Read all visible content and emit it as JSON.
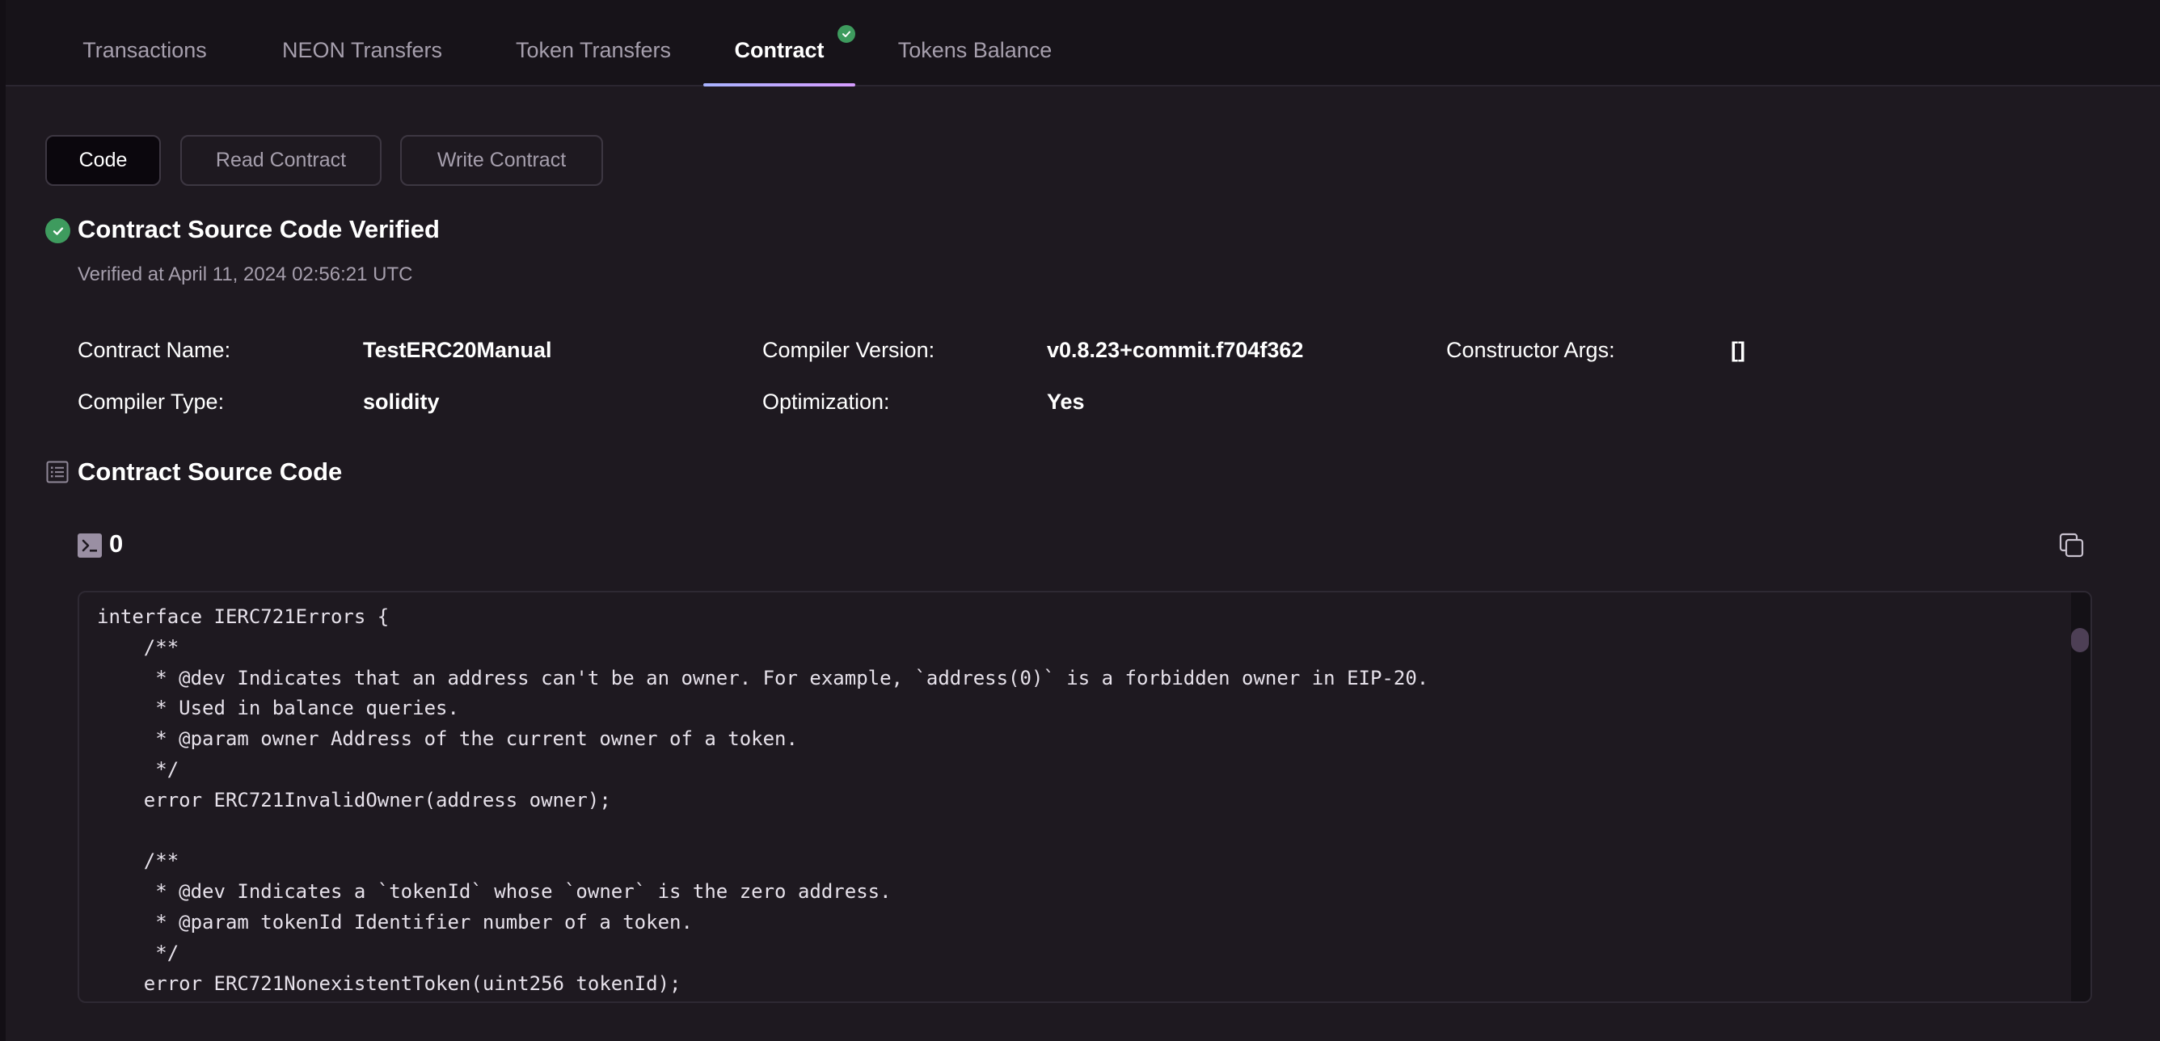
{
  "tabs": [
    {
      "label": "Transactions",
      "active": false
    },
    {
      "label": "NEON Transfers",
      "active": false
    },
    {
      "label": "Token Transfers",
      "active": false
    },
    {
      "label": "Contract",
      "active": true,
      "badge": "check-circle-icon"
    },
    {
      "label": "Tokens Balance",
      "active": false
    }
  ],
  "subtabs": [
    {
      "label": "Code",
      "active": true
    },
    {
      "label": "Read Contract",
      "active": false
    },
    {
      "label": "Write Contract",
      "active": false
    }
  ],
  "verification": {
    "title": "Contract Source Code Verified",
    "verified_at": "Verified at April 11, 2024 02:56:21 UTC",
    "icon": "check-circle-icon"
  },
  "info": {
    "contract_name_label": "Contract Name:",
    "contract_name": "TestERC20Manual",
    "compiler_version_label": "Compiler Version:",
    "compiler_version": "v0.8.23+commit.f704f362",
    "constructor_args_label": "Constructor Args:",
    "constructor_args": "[]",
    "compiler_type_label": "Compiler Type:",
    "compiler_type": "solidity",
    "optimization_label": "Optimization:",
    "optimization": "Yes"
  },
  "source": {
    "title": "Contract Source Code",
    "icon": "list-icon",
    "file_icon": "terminal-icon",
    "file_name": "0",
    "copy_icon": "copy-icon",
    "code": "interface IERC721Errors {\n    /**\n     * @dev Indicates that an address can't be an owner. For example, `address(0)` is a forbidden owner in EIP-20.\n     * Used in balance queries.\n     * @param owner Address of the current owner of a token.\n     */\n    error ERC721InvalidOwner(address owner);\n\n    /**\n     * @dev Indicates a `tokenId` whose `owner` is the zero address.\n     * @param tokenId Identifier number of a token.\n     */\n    error ERC721NonexistentToken(uint256 tokenId);"
  },
  "colors": {
    "background": "#1e1920",
    "tabbar": "#171319",
    "accent_green": "#3e9b5e",
    "muted_text": "#a69fad",
    "tab_underline_start": "#a8b3ff",
    "tab_underline_end": "#d69cff"
  }
}
